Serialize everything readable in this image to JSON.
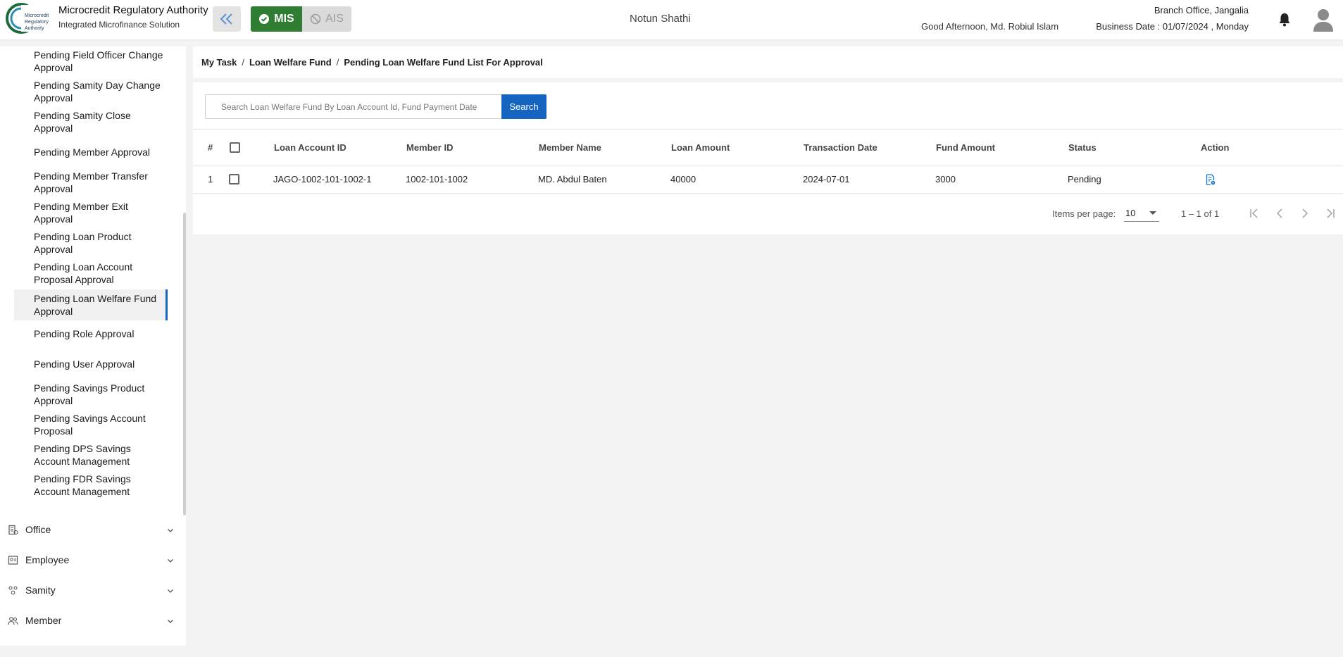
{
  "header": {
    "logo_text": "Microcredit Regulatory Authority",
    "org_name": "Microcredit Regulatory Authority",
    "org_subtitle": "Integrated Microfinance Solution",
    "mis_label": "MIS",
    "ais_label": "AIS",
    "app_name": "Notun Shathi",
    "greeting": "Good Afternoon, Md. Robiul Islam",
    "branch": "Branch Office, Jangalia",
    "business_date": "Business Date : 01/07/2024 , Monday"
  },
  "sidebar": {
    "sub_items": [
      {
        "label": "Pending Field Officer Change Approval"
      },
      {
        "label": "Pending Samity Day Change Approval"
      },
      {
        "label": "Pending Samity Close Approval"
      },
      {
        "label": "Pending Member Approval"
      },
      {
        "label": "Pending Member Transfer Approval"
      },
      {
        "label": "Pending Member Exit Approval"
      },
      {
        "label": "Pending Loan Product Approval"
      },
      {
        "label": "Pending Loan Account Proposal Approval"
      },
      {
        "label": "Pending Loan Welfare Fund Approval"
      },
      {
        "label": "Pending Role Approval"
      },
      {
        "label": "Pending User Approval"
      },
      {
        "label": "Pending Savings Product Approval"
      },
      {
        "label": "Pending Savings Account Proposal"
      },
      {
        "label": "Pending DPS Savings Account Management"
      },
      {
        "label": "Pending FDR Savings Account Management"
      }
    ],
    "groups": [
      {
        "label": "Office",
        "icon": "office-icon"
      },
      {
        "label": "Employee",
        "icon": "employee-icon"
      },
      {
        "label": "Samity",
        "icon": "samity-icon"
      },
      {
        "label": "Member",
        "icon": "member-icon"
      }
    ],
    "accent_color": "#1565c0"
  },
  "breadcrumb": {
    "items": [
      "My Task",
      "Loan Welfare Fund",
      "Pending Loan Welfare Fund List For Approval"
    ],
    "separator": "/"
  },
  "search": {
    "placeholder": "Search Loan Welfare Fund By Loan Account Id, Fund Payment Date",
    "value": "",
    "button_label": "Search"
  },
  "table": {
    "columns": [
      "#",
      "",
      "Loan Account ID",
      "Member ID",
      "Member Name",
      "Loan Amount",
      "Transaction Date",
      "Fund Amount",
      "Status",
      "Action"
    ],
    "rows": [
      {
        "index": "1",
        "loan_account_id": "JAGO-1002-101-1002-1",
        "member_id": "1002-101-1002",
        "member_name": "MD. Abdul Baten",
        "loan_amount": "40000",
        "transaction_date": "2024-07-01",
        "fund_amount": "3000",
        "status": "Pending",
        "action_icon": "view-details-icon"
      }
    ]
  },
  "paginator": {
    "items_per_page_label": "Items per page:",
    "items_per_page": "10",
    "range": "1 – 1 of 1"
  },
  "colors": {
    "primary": "#1565c0",
    "mis_green": "#2e7d32",
    "ais_disabled": "#dadada"
  }
}
